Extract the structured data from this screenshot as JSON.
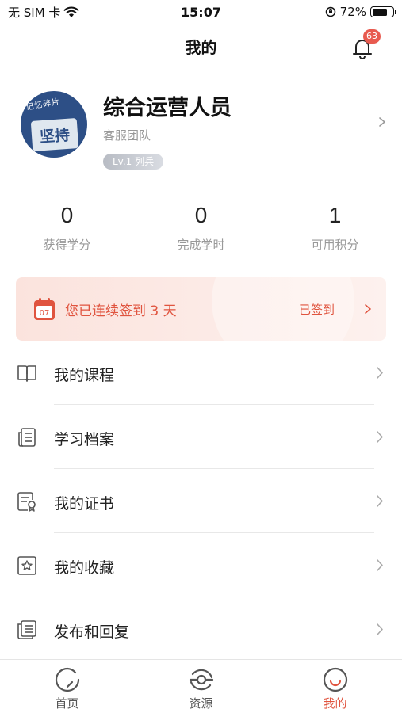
{
  "status_bar": {
    "carrier": "无 SIM 卡",
    "time": "15:07",
    "battery": "72%",
    "battery_level": 0.72
  },
  "header": {
    "title": "我的",
    "notification_count": "63"
  },
  "profile": {
    "avatar_caption": "记忆碎片",
    "avatar_text": "坚持",
    "name": "综合运营人员",
    "team": "客服团队",
    "level": "Lv.1 列兵"
  },
  "stats": [
    {
      "value": "0",
      "label": "获得学分"
    },
    {
      "value": "0",
      "label": "完成学时"
    },
    {
      "value": "1",
      "label": "可用积分"
    }
  ],
  "checkin": {
    "calendar_day": "07",
    "text": "您已连续签到 3 天",
    "status": "已签到"
  },
  "menu": [
    {
      "label": "我的课程",
      "icon": "book-icon"
    },
    {
      "label": "学习档案",
      "icon": "document-list-icon"
    },
    {
      "label": "我的证书",
      "icon": "certificate-icon"
    },
    {
      "label": "我的收藏",
      "icon": "star-bookmark-icon"
    },
    {
      "label": "发布和回复",
      "icon": "stacked-pages-icon"
    }
  ],
  "tabs": [
    {
      "label": "首页",
      "icon": "home-circle-icon"
    },
    {
      "label": "资源",
      "icon": "resource-icon"
    },
    {
      "label": "我的",
      "icon": "smile-icon"
    }
  ],
  "colors": {
    "accent": "#e0543f",
    "badge": "#e85a4f",
    "checkin_bg": "#fbe3dd"
  }
}
